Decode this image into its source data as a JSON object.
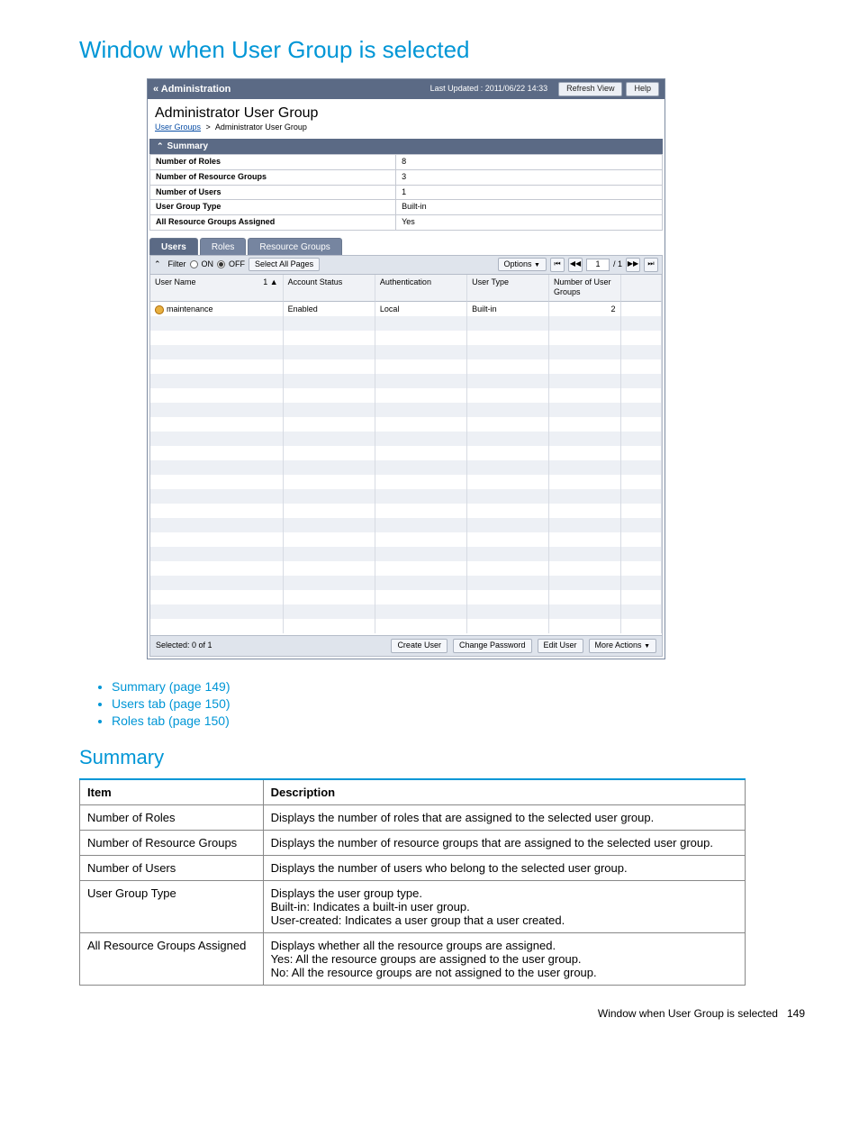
{
  "doc": {
    "heading": "Window when User Group is selected",
    "links": [
      "Summary (page 149)",
      "Users tab (page 150)",
      "Roles tab (page 150)"
    ],
    "section": "Summary",
    "table": {
      "head_item": "Item",
      "head_desc": "Description",
      "rows": [
        {
          "item": "Number of Roles",
          "desc": "Displays the number of roles that are assigned to the selected user group."
        },
        {
          "item": "Number of Resource Groups",
          "desc": "Displays the number of resource groups that are assigned to the selected user group."
        },
        {
          "item": "Number of Users",
          "desc": "Displays the number of users who belong to the selected user group."
        },
        {
          "item": "User Group Type",
          "desc": "Displays the user group type.\nBuilt-in: Indicates a built-in user group.\nUser-created: Indicates a user group that a user created."
        },
        {
          "item": "All Resource Groups Assigned",
          "desc": "Displays whether all the resource groups are assigned.\nYes: All the resource groups are assigned to the user group.\nNo: All the resource groups are not assigned to the user group."
        }
      ]
    },
    "footer_label": "Window when User Group is selected",
    "footer_page": "149"
  },
  "app": {
    "title": "« Administration",
    "updated": "Last Updated : 2011/06/22 14:33",
    "refresh": "Refresh View",
    "help": "Help",
    "group_title": "Administrator User Group",
    "crumb_link": "User Groups",
    "crumb_current": "Administrator User Group",
    "summary_hdr": "Summary",
    "summary_rows": [
      {
        "label": "Number of Roles",
        "value": "8"
      },
      {
        "label": "Number of Resource Groups",
        "value": "3"
      },
      {
        "label": "Number of Users",
        "value": "1"
      },
      {
        "label": "User Group Type",
        "value": "Built-in"
      },
      {
        "label": "All Resource Groups Assigned",
        "value": "Yes"
      }
    ],
    "tabs": {
      "users": "Users",
      "roles": "Roles",
      "resgroups": "Resource Groups"
    },
    "filter": {
      "label": "Filter",
      "on": "ON",
      "off": "OFF",
      "select_all": "Select All Pages",
      "options": "Options",
      "page_cur": "1",
      "page_total": "/ 1"
    },
    "cols": {
      "user_name": "User Name",
      "account_status": "Account Status",
      "authentication": "Authentication",
      "user_type": "User Type",
      "num_groups": "Number of User Groups",
      "sort": "1 ▲"
    },
    "row": {
      "user_name": "maintenance",
      "account_status": "Enabled",
      "authentication": "Local",
      "user_type": "Built-in",
      "num_groups": "2"
    },
    "foot": {
      "selected": "Selected:  0   of  1",
      "create_user": "Create User",
      "change_pw": "Change Password",
      "edit_user": "Edit User",
      "more": "More Actions"
    }
  }
}
